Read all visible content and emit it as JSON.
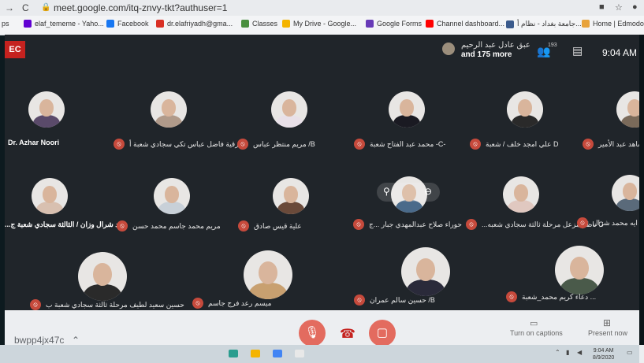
{
  "browser": {
    "url": "meet.google.com/itq-znvy-tkt?authuser=1",
    "bookmarks": [
      {
        "label": "elaf_tememe - Yaho...",
        "color": "#6001d2",
        "icon": "mail-icon"
      },
      {
        "label": "Facebook",
        "color": "#1877f2",
        "icon": "facebook-icon"
      },
      {
        "label": "dr.elafriyadh@gma...",
        "color": "#d93025",
        "icon": "gmail-icon"
      },
      {
        "label": "Classes",
        "color": "#4a8f3f",
        "icon": "classroom-icon"
      },
      {
        "label": "My Drive - Google...",
        "color": "#f4b400",
        "icon": "drive-icon"
      },
      {
        "label": "Google Forms",
        "color": "#673ab7",
        "icon": "forms-icon"
      },
      {
        "label": "Channel dashboard...",
        "color": "#ff0000",
        "icon": "youtube-icon"
      },
      {
        "label": "جامعة بغداد - نظام أ...",
        "color": "#3a5a8c",
        "icon": "university-icon"
      },
      {
        "label": "Home | Edmodo",
        "color": "#e8a33c",
        "icon": "edmodo-icon"
      }
    ],
    "bookmark_prefix": "ps"
  },
  "meet": {
    "rec_label": "EC",
    "presenter_name": "عبق عادل عبد الرحيم",
    "more_label": "and 175 more",
    "people_count": "193",
    "time": "9:04 AM",
    "participants": [
      {
        "name": "Dr. Azhar Noori",
        "muted": false,
        "shirt": "#5a4a6a"
      },
      {
        "name": "رقية فاضل عباس تكي سجادي شعبة أ",
        "muted": true,
        "shirt": "#b09a8a"
      },
      {
        "name": "مريم منتظر عباس /B",
        "muted": true,
        "shirt": "#e8e0e8"
      },
      {
        "name": "محمد عبد الفتاح شعبة -C-",
        "muted": true,
        "shirt": "#1a1a22"
      },
      {
        "name": "علي امجد خلف / شعبة D",
        "muted": true,
        "shirt": "#2a2a2a"
      },
      {
        "name": "فاطمة ساهد عبد الأمير",
        "muted": true,
        "shirt": "#7a6a5a"
      },
      {
        "name": "...ـد شرال وزان / الثالثة سجادي شعبة ج",
        "muted": false,
        "shirt": "#d8c0b0"
      },
      {
        "name": "مريم محمد جاسم محمد حسن",
        "muted": true,
        "shirt": "#c8d0d8"
      },
      {
        "name": "علية قيس صادق",
        "muted": true,
        "shirt": "#6a4a3a"
      },
      {
        "name": "حوراء صلاح عبدالمهدي جبار ...ج",
        "muted": true,
        "shirt": "#4a6a8a"
      },
      {
        "name": "...ناظم مزعل مرحلة ثالثة سجادي شعبه C",
        "muted": true,
        "shirt": "#e0c8c0"
      },
      {
        "name": "ايه محمد شرال",
        "muted": true,
        "shirt": "#5a6a7a"
      },
      {
        "name": "حسين سعيد لطيف مرحلة ثالثة سجادي شعبة ب",
        "muted": true,
        "shirt": "#2a2a2a"
      },
      {
        "name": "ميسم رعد فرج جاسم",
        "muted": true,
        "shirt": "#c8a070"
      },
      {
        "name": "حسين سالم عمران /B",
        "muted": true,
        "shirt": "#2a2a3a"
      },
      {
        "name": "دعاء كريم محمد_شعبة ...",
        "muted": true,
        "shirt": "#4a5a4a"
      }
    ],
    "meeting_code": "bwpp4jx47c",
    "captions_label": "Turn on captions",
    "present_label": "Present now"
  },
  "taskbar": {
    "time": "9:04 AM",
    "date": "8/9/2020"
  }
}
